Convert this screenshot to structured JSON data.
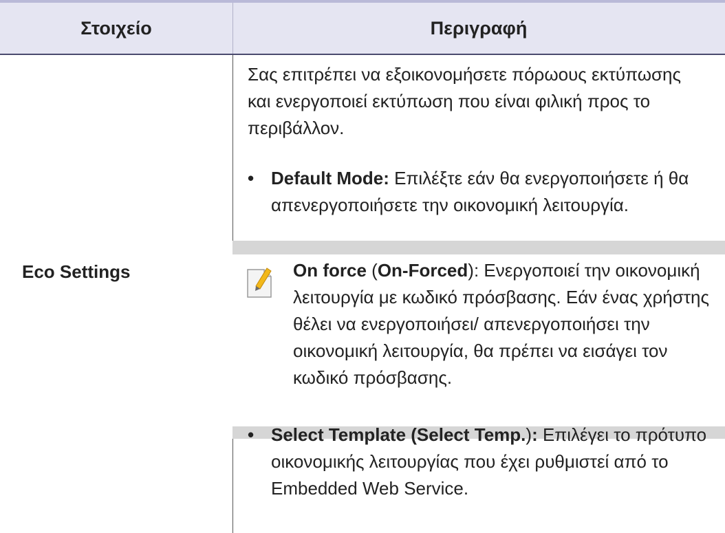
{
  "header": {
    "col1": "Στοιχείο",
    "col2": "Περιγραφή"
  },
  "row": {
    "item": "Eco Settings",
    "intro": "Σας επιτρέπει να εξοικονομήσετε πόρωους εκτύπωσης και ενεργοποιεί εκτύπωση που είναι φιλική προς το περιβάλλον.",
    "bullet1": {
      "term": "Default Mode:",
      "text": " Επιλέξτε εάν θα ενεργοποιήσετε ή θα απενεργοποιήσετε την οικονομική λειτουργία."
    },
    "note": {
      "icon": "note-pencil-icon",
      "term1": "On force",
      "paren_open": " (",
      "term2": "On-Forced",
      "paren_close": ")",
      "text": ": Ενεργοποιεί την οικονομική λειτουργία με κωδικό πρόσβασης. Εάν ένας χρήστης θέλει να ενεργοποιήσει/ απενεργοποιήσει την οικονομική λειτουργία, θα πρέπει να εισάγει τον κωδικό πρόσβασης."
    },
    "bullet2": {
      "term": "Select Template (Select Temp.",
      "paren_close": ")",
      "colon": ":",
      "text": " Επιλέγει το πρότυπο οικονομικής λειτουργίας που έχει ρυθμιστεί από το Embedded Web Service."
    }
  },
  "bullet_glyph": "•"
}
